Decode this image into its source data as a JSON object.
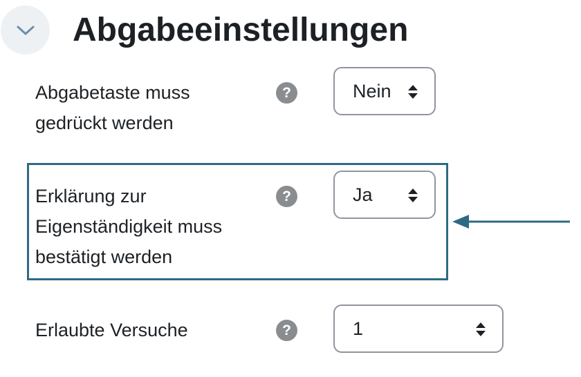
{
  "section": {
    "title": "Abgabeeinstellungen",
    "toggle_icon": "chevron-down-icon"
  },
  "fields": [
    {
      "label_lines": [
        "Abgabetaste muss",
        "gedrückt werden"
      ],
      "help_glyph": "?",
      "value": "Nein"
    },
    {
      "label_lines": [
        "Erklärung zur",
        "Eigenständigkeit muss",
        "bestätigt werden"
      ],
      "help_glyph": "?",
      "value": "Ja",
      "highlighted": true
    },
    {
      "label_lines": [
        "Erlaubte Versuche"
      ],
      "help_glyph": "?",
      "value": "1"
    }
  ],
  "colors": {
    "highlight_border": "#2e6a83",
    "arrow": "#2e6a83",
    "help_icon_bg": "#8a8d90",
    "toggle_bg": "#eef1f4",
    "text": "#1d2125"
  }
}
